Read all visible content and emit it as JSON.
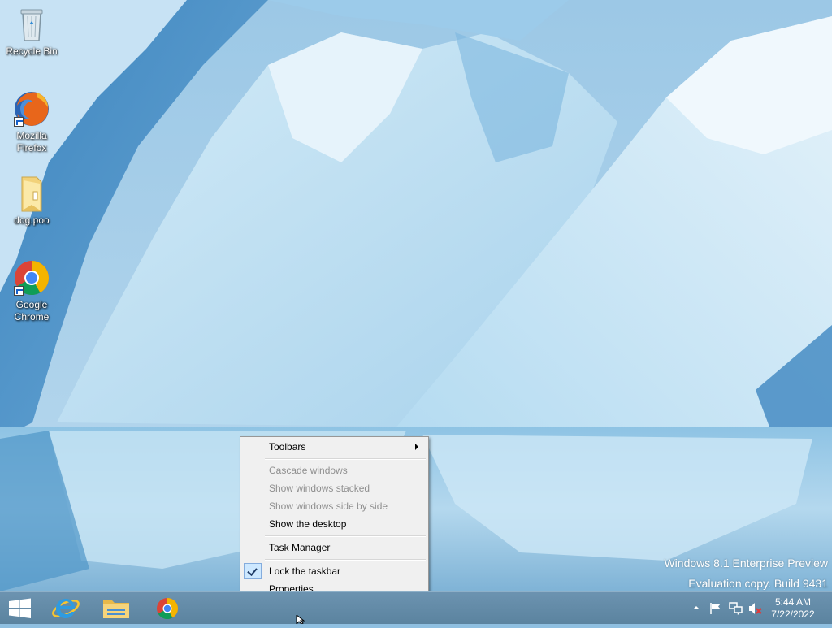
{
  "desktop": {
    "icons": [
      {
        "label": "Recycle Bin"
      },
      {
        "label": "Mozilla Firefox"
      },
      {
        "label": "dog.poo"
      },
      {
        "label": "Google Chrome"
      }
    ]
  },
  "watermark": {
    "line1": "Windows 8.1 Enterprise Preview",
    "line2": "Evaluation copy. Build 9431"
  },
  "context_menu": {
    "toolbars": "Toolbars",
    "cascade": "Cascade windows",
    "stacked": "Show windows stacked",
    "side_by_side": "Show windows side by side",
    "show_desktop": "Show the desktop",
    "task_manager": "Task Manager",
    "lock_taskbar": "Lock the taskbar",
    "properties": "Properties"
  },
  "taskbar": {
    "clock_time": "5:44 AM",
    "clock_date": "7/22/2022"
  },
  "colors": {
    "taskbar": "#5f87a3",
    "menu_bg": "#f0f0f0",
    "menu_disabled": "#8f8f8f",
    "check_highlight": "#cde8ff"
  }
}
